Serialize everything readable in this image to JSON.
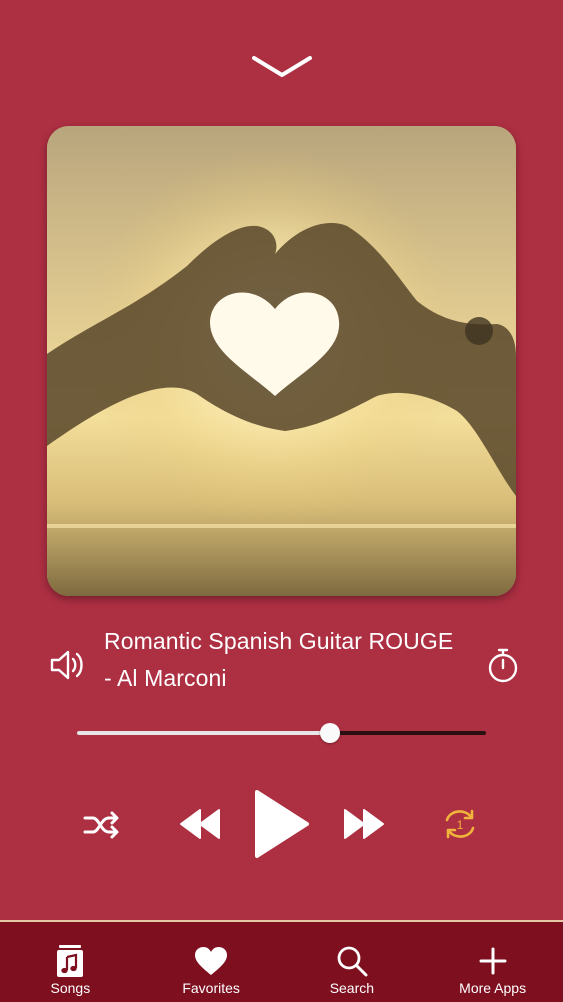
{
  "header": {
    "collapse_icon": "chevron-down-icon"
  },
  "player": {
    "title": "Romantic Spanish Guitar ROUGE",
    "artist_line": "- Al Marconi",
    "progress_fraction": 0.618,
    "volume_icon": "speaker-icon",
    "timer_icon": "stopwatch-icon"
  },
  "controls": {
    "shuffle_icon": "shuffle-icon",
    "rewind_icon": "rewind-icon",
    "play_icon": "play-icon",
    "forward_icon": "fast-forward-icon",
    "repeat_icon": "repeat-one-icon",
    "repeat_badge": "1"
  },
  "tabs": [
    {
      "label": "Songs",
      "icon": "music-note-icon"
    },
    {
      "label": "Favorites",
      "icon": "heart-icon"
    },
    {
      "label": "Search",
      "icon": "search-icon"
    },
    {
      "label": "More Apps",
      "icon": "plus-icon"
    }
  ],
  "colors": {
    "background": "#ad2f42",
    "tabbar": "#7d0f1f",
    "tab_divider": "#e4c9a4",
    "repeat_accent": "#f0b43a"
  }
}
